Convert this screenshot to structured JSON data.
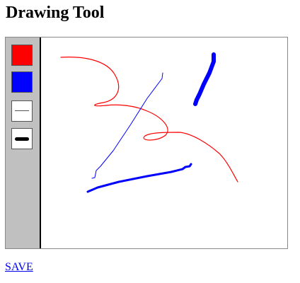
{
  "page": {
    "title": "Drawing Tool",
    "save_label": "SAVE"
  },
  "toolbar": {
    "tools": [
      {
        "name": "color-red",
        "type": "color",
        "color": "#ff0000"
      },
      {
        "name": "color-blue",
        "type": "color",
        "color": "#0000ff"
      },
      {
        "name": "line-thin",
        "type": "width",
        "icon": "thin-line-icon"
      },
      {
        "name": "line-thick",
        "type": "width",
        "icon": "thick-line-icon"
      }
    ]
  },
  "colors": {
    "red": "#ff0000",
    "blue": "#0000ff",
    "toolbar_bg": "#c0c0c0",
    "link": "#0000ee"
  }
}
